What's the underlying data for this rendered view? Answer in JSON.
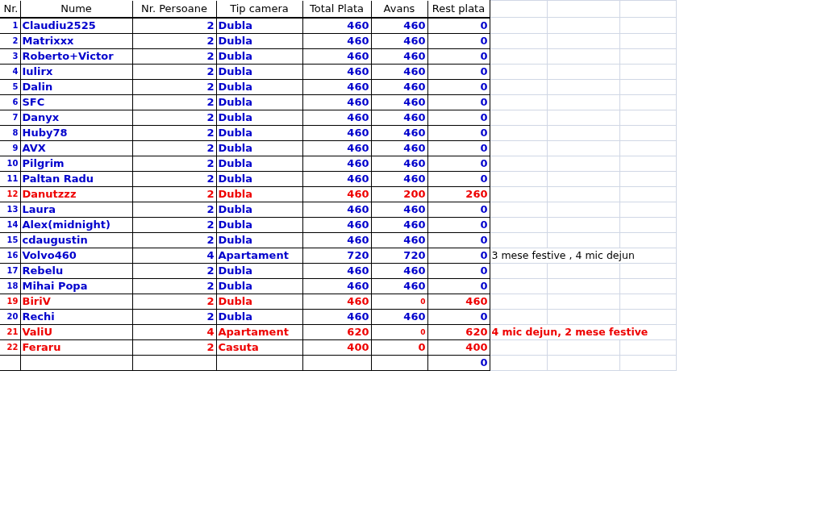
{
  "columns": [
    "Nr.",
    "Nume",
    "Nr. Persoane",
    "Tip camera",
    "Total Plata",
    "Avans",
    "Rest plata"
  ],
  "rows": [
    {
      "nr": "1",
      "name": "Claudiu2525",
      "persons": "2",
      "room": "Dubla",
      "total": "460",
      "avans": "460",
      "rest": "0",
      "color": "#0000cc",
      "small_avans": false
    },
    {
      "nr": "2",
      "name": "Matrixxx",
      "persons": "2",
      "room": "Dubla",
      "total": "460",
      "avans": "460",
      "rest": "0",
      "color": "#0000cc",
      "small_avans": false
    },
    {
      "nr": "3",
      "name": "Roberto+Victor",
      "persons": "2",
      "room": "Dubla",
      "total": "460",
      "avans": "460",
      "rest": "0",
      "color": "#0000cc",
      "small_avans": false
    },
    {
      "nr": "4",
      "name": "Iulirx",
      "persons": "2",
      "room": "Dubla",
      "total": "460",
      "avans": "460",
      "rest": "0",
      "color": "#0000cc",
      "small_avans": false
    },
    {
      "nr": "5",
      "name": "Dalin",
      "persons": "2",
      "room": "Dubla",
      "total": "460",
      "avans": "460",
      "rest": "0",
      "color": "#0000cc",
      "small_avans": false
    },
    {
      "nr": "6",
      "name": "SFC",
      "persons": "2",
      "room": "Dubla",
      "total": "460",
      "avans": "460",
      "rest": "0",
      "color": "#0000cc",
      "small_avans": false
    },
    {
      "nr": "7",
      "name": "Danyx",
      "persons": "2",
      "room": "Dubla",
      "total": "460",
      "avans": "460",
      "rest": "0",
      "color": "#0000cc",
      "small_avans": false
    },
    {
      "nr": "8",
      "name": "Huby78",
      "persons": "2",
      "room": "Dubla",
      "total": "460",
      "avans": "460",
      "rest": "0",
      "color": "#0000cc",
      "small_avans": false
    },
    {
      "nr": "9",
      "name": "AVX",
      "persons": "2",
      "room": "Dubla",
      "total": "460",
      "avans": "460",
      "rest": "0",
      "color": "#0000cc",
      "small_avans": false
    },
    {
      "nr": "10",
      "name": "Pilgrim",
      "persons": "2",
      "room": "Dubla",
      "total": "460",
      "avans": "460",
      "rest": "0",
      "color": "#0000cc",
      "small_avans": false
    },
    {
      "nr": "11",
      "name": "Paltan Radu",
      "persons": "2",
      "room": "Dubla",
      "total": "460",
      "avans": "460",
      "rest": "0",
      "color": "#0000cc",
      "small_avans": false
    },
    {
      "nr": "12",
      "name": "Danutzzz",
      "persons": "2",
      "room": "Dubla",
      "total": "460",
      "avans": "200",
      "rest": "260",
      "color": "#ee0000",
      "small_avans": false
    },
    {
      "nr": "13",
      "name": "Laura",
      "persons": "2",
      "room": "Dubla",
      "total": "460",
      "avans": "460",
      "rest": "0",
      "color": "#0000cc",
      "small_avans": false
    },
    {
      "nr": "14",
      "name": "Alex(midnight)",
      "persons": "2",
      "room": "Dubla",
      "total": "460",
      "avans": "460",
      "rest": "0",
      "color": "#0000cc",
      "small_avans": false
    },
    {
      "nr": "15",
      "name": "cdaugustin",
      "persons": "2",
      "room": "Dubla",
      "total": "460",
      "avans": "460",
      "rest": "0",
      "color": "#0000cc",
      "small_avans": false
    },
    {
      "nr": "16",
      "name": "Volvo460",
      "persons": "4",
      "room": "Apartament",
      "total": "720",
      "avans": "720",
      "rest": "0",
      "color": "#0000cc",
      "small_avans": false,
      "note": {
        "text": "3 mese festive , 4 mic dejun",
        "emphasis": false
      }
    },
    {
      "nr": "17",
      "name": "Rebelu",
      "persons": "2",
      "room": "Dubla",
      "total": "460",
      "avans": "460",
      "rest": "0",
      "color": "#0000cc",
      "small_avans": false
    },
    {
      "nr": "18",
      "name": "Mihai Popa",
      "persons": "2",
      "room": "Dubla",
      "total": "460",
      "avans": "460",
      "rest": "0",
      "color": "#0000cc",
      "small_avans": false
    },
    {
      "nr": "19",
      "name": "BiriV",
      "persons": "2",
      "room": "Dubla",
      "total": "460",
      "avans": "0",
      "rest": "460",
      "color": "#ee0000",
      "small_avans": true
    },
    {
      "nr": "20",
      "name": "Rechi",
      "persons": "2",
      "room": "Dubla",
      "total": "460",
      "avans": "460",
      "rest": "0",
      "color": "#0000cc",
      "small_avans": false
    },
    {
      "nr": "21",
      "name": "ValiU",
      "persons": "4",
      "room": "Apartament",
      "total": "620",
      "avans": "0",
      "rest": "620",
      "color": "#ee0000",
      "small_avans": true,
      "note": {
        "text": "4 mic dejun, 2 mese festive",
        "emphasis": true
      }
    },
    {
      "nr": "22",
      "name": "Feraru",
      "persons": "2",
      "room": "Casuta",
      "total": "400",
      "avans": "0",
      "rest": "400",
      "color": "#ee0000",
      "small_avans": false
    }
  ],
  "footer": {
    "rest": "0"
  }
}
